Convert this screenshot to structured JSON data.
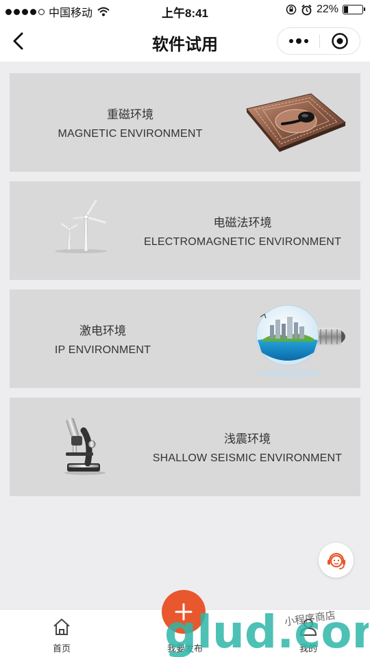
{
  "status_bar": {
    "carrier": "中国移动",
    "time": "上午8:41",
    "battery": "22%",
    "battery_level": 0.22
  },
  "nav": {
    "title": "软件试用"
  },
  "cards": [
    {
      "cn": "重磁环境",
      "en": "MAGNETIC ENVIRONMENT",
      "icon": "compass-icon"
    },
    {
      "cn": "电磁法环境",
      "en": "ELECTROMAGNETIC ENVIRONMENT",
      "icon": "wind-turbine-icon"
    },
    {
      "cn": "激电环境",
      "en": "IP ENVIRONMENT",
      "icon": "lightbulb-city-icon"
    },
    {
      "cn": "浅震环境",
      "en": "SHALLOW SEISMIC ENVIRONMENT",
      "icon": "microscope-icon"
    }
  ],
  "tabbar": {
    "home": "首页",
    "publish": "我要发布",
    "mine": "我的"
  },
  "watermark": {
    "main": "glud.com",
    "sub": "小程序商店"
  },
  "colors": {
    "accent": "#e8572d",
    "card_bg": "#d9d9d9",
    "page_bg": "#ededf0"
  }
}
